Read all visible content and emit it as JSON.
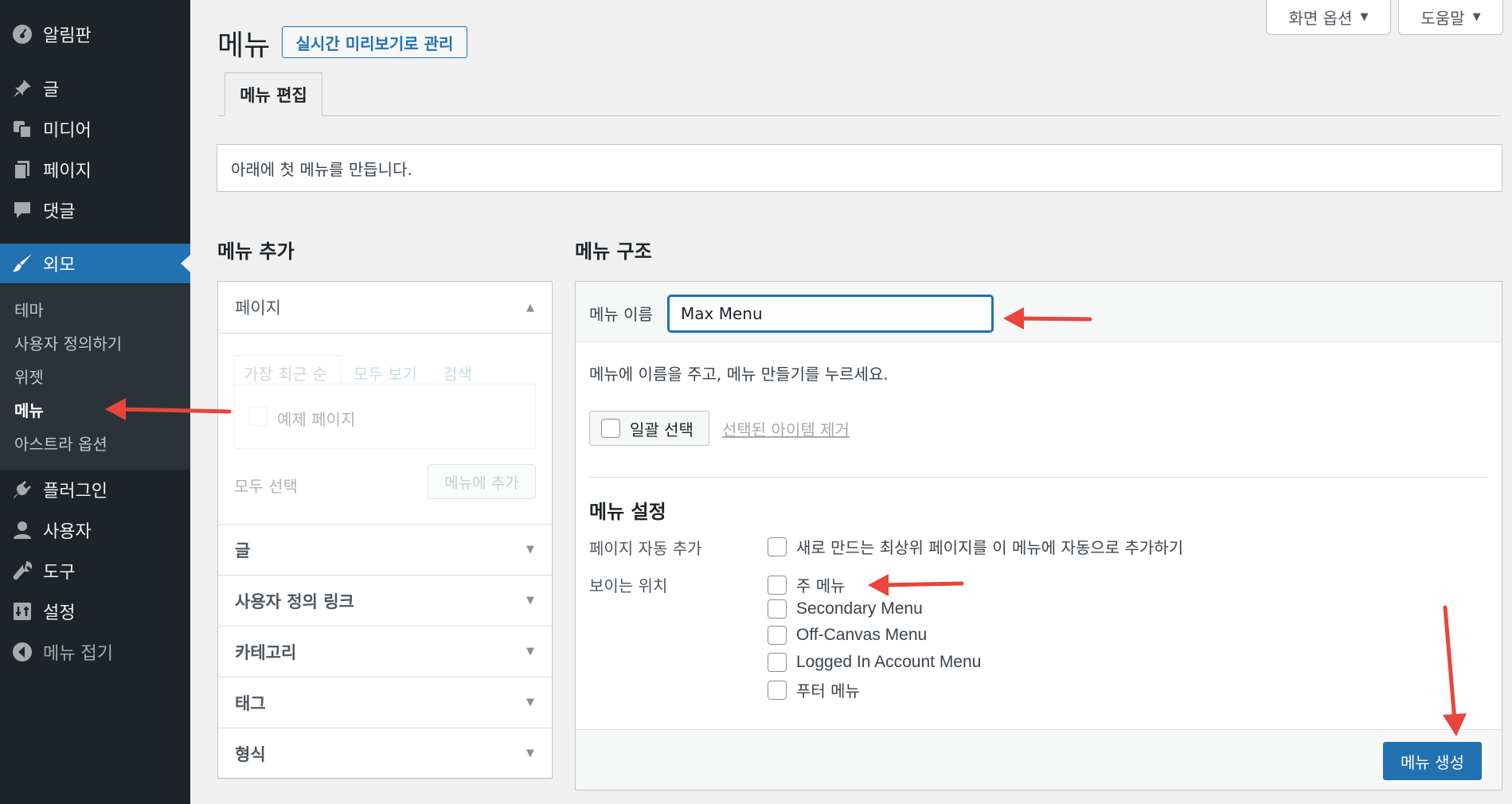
{
  "sidebar": {
    "items": [
      {
        "label": "알림판",
        "icon": "dashboard-icon"
      },
      {
        "label": "글",
        "icon": "pin-icon"
      },
      {
        "label": "미디어",
        "icon": "media-icon"
      },
      {
        "label": "페이지",
        "icon": "pages-icon"
      },
      {
        "label": "댓글",
        "icon": "comment-icon"
      },
      {
        "label": "외모",
        "icon": "brush-icon"
      },
      {
        "label": "플러그인",
        "icon": "plugin-icon"
      },
      {
        "label": "사용자",
        "icon": "user-icon"
      },
      {
        "label": "도구",
        "icon": "wrench-icon"
      },
      {
        "label": "설정",
        "icon": "settings-icon"
      },
      {
        "label": "메뉴 접기",
        "icon": "collapse-icon"
      }
    ],
    "submenu": [
      "테마",
      "사용자 정의하기",
      "위젯",
      "메뉴",
      "아스트라 옵션"
    ]
  },
  "header": {
    "title": "메뉴",
    "live_preview": "실시간 미리보기로 관리",
    "screen_options": "화면 옵션",
    "help": "도움말",
    "tab_edit": "메뉴 편집"
  },
  "notice": "아래에 첫 메뉴를 만듭니다.",
  "add_menu": {
    "heading": "메뉴 추가",
    "pages": {
      "title": "페이지",
      "tabs": [
        "가장 최근 순",
        "모두 보기",
        "검색"
      ],
      "item": "예제 페이지",
      "select_all": "모두 선택",
      "add_button": "메뉴에 추가"
    },
    "sections": [
      "글",
      "사용자 정의 링크",
      "카테고리",
      "태그",
      "형식"
    ]
  },
  "structure": {
    "heading": "메뉴 구조",
    "name_label": "메뉴 이름",
    "name_value": "Max Menu",
    "instructions": "메뉴에 이름을 주고, 메뉴 만들기를 누르세요.",
    "bulk_select": "일괄 선택",
    "remove_selected": "선택된 아이템 제거",
    "settings_heading": "메뉴 설정",
    "auto_add_label": "페이지 자동 추가",
    "auto_add_option": "새로 만드는 최상위 페이지를 이 메뉴에 자동으로 추가하기",
    "location_label": "보이는 위치",
    "locations": [
      "주 메뉴",
      "Secondary Menu",
      "Off-Canvas Menu",
      "Logged In Account Menu",
      "푸터 메뉴"
    ],
    "create_button": "메뉴 생성"
  },
  "colors": {
    "sidebar_bg": "#1d2327",
    "accent": "#2271b1",
    "annotation_arrow": "#e8453c"
  }
}
